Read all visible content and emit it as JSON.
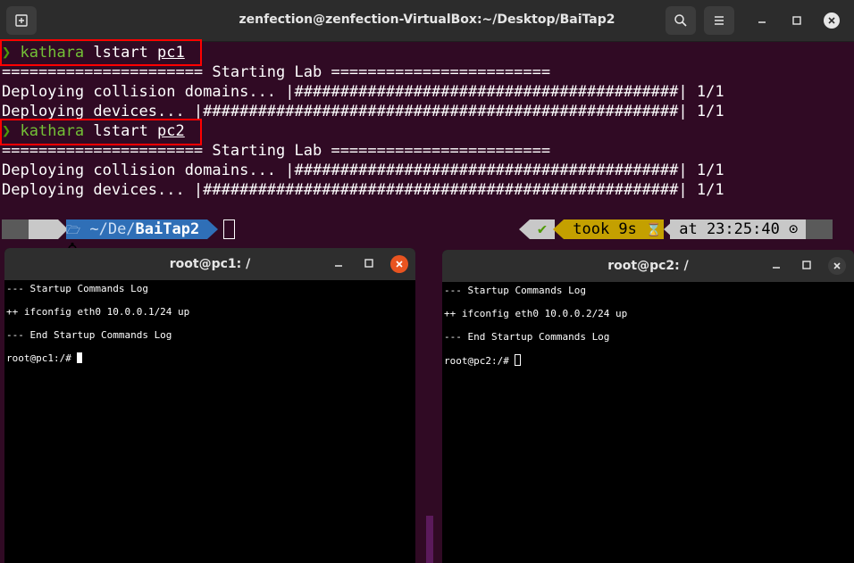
{
  "main_window": {
    "title": "zenfection@zenfection-VirtualBox:~/Desktop/BaiTap2"
  },
  "terminal": {
    "prompt_symbol": "❯",
    "cmd1": {
      "word1": "kathara",
      "word2": " lstart ",
      "arg": "pc1"
    },
    "cmd2": {
      "word1": "kathara",
      "word2": " lstart ",
      "arg": "pc2"
    },
    "starting_lab": "====================== Starting Lab ========================",
    "deploy_cd": "Deploying collision domains... |##########################################| 1/1",
    "deploy_dev": "Deploying devices... |####################################################| 1/1"
  },
  "powerline": {
    "os_icon": "",
    "folder_icon": "🗁",
    "path_prefix": " ~/De/",
    "path_dir": "BaiTap2",
    "check": "✔",
    "took": " took 9s ",
    "hourglass": "⌛",
    "time": " at 23:25:40 ",
    "clock": "⊙"
  },
  "pc1": {
    "title": "root@pc1: /",
    "lines": [
      "--- Startup Commands Log",
      "++ ifconfig eth0 10.0.0.1/24 up",
      "--- End Startup Commands Log"
    ],
    "prompt": "root@pc1:/# "
  },
  "pc2": {
    "title": "root@pc2: /",
    "lines": [
      "--- Startup Commands Log",
      "++ ifconfig eth0 10.0.0.2/24 up",
      "--- End Startup Commands Log"
    ],
    "prompt": "root@pc2:/# "
  },
  "colors": {
    "terminal_bg": "#300a24",
    "prompt_green": "#4e9a06",
    "highlight_red": "#ff0000",
    "pl_gray": "#c8c8c8",
    "pl_blue": "#2f6fb7",
    "pl_yellow": "#c4a000",
    "close_orange": "#e95420"
  }
}
